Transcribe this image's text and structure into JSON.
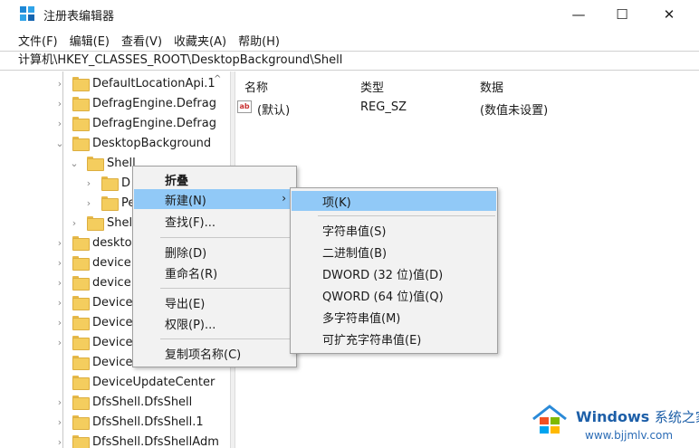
{
  "window": {
    "title": "注册表编辑器",
    "minimize_glyph": "—",
    "maximize_glyph": "☐",
    "close_glyph": "✕"
  },
  "menu": [
    "文件(F)",
    "编辑(E)",
    "查看(V)",
    "收藏夹(A)",
    "帮助(H)"
  ],
  "address": "计算机\\HKEY_CLASSES_ROOT\\DesktopBackground\\Shell",
  "tree": {
    "items": [
      {
        "label": "DefaultLocationApi.1",
        "caret": "›"
      },
      {
        "label": "DefragEngine.Defrag",
        "caret": "›"
      },
      {
        "label": "DefragEngine.Defrag",
        "caret": "›"
      },
      {
        "label": "DesktopBackground",
        "caret": "⌄"
      },
      {
        "label": "Shell",
        "caret": "⌄"
      },
      {
        "label": "D",
        "caret": "›"
      },
      {
        "label": "Pe",
        "caret": "›"
      },
      {
        "label": "Shell",
        "caret": "›"
      },
      {
        "label": "desktop",
        "caret": "›"
      },
      {
        "label": "device",
        "caret": "›"
      },
      {
        "label": "device.",
        "caret": "›"
      },
      {
        "label": "DeviceD",
        "caret": "›"
      },
      {
        "label": "DeviceF",
        "caret": "›"
      },
      {
        "label": "DeviceF",
        "caret": "›"
      },
      {
        "label": "DeviceU",
        "caret": ""
      },
      {
        "label": "DeviceUpdateCenter",
        "caret": ""
      },
      {
        "label": "DfsShell.DfsShell",
        "caret": "›"
      },
      {
        "label": "DfsShell.DfsShell.1",
        "caret": "›"
      },
      {
        "label": "DfsShell.DfsShellAdm",
        "caret": "›"
      }
    ],
    "scroll_up_glyph": "^"
  },
  "list": {
    "columns": [
      "名称",
      "类型",
      "数据"
    ],
    "rows": [
      {
        "icon": "ab",
        "name": "(默认)",
        "type": "REG_SZ",
        "data": "(数值未设置)"
      }
    ]
  },
  "context_menu": {
    "items": [
      "折叠",
      "新建(N)",
      "查找(F)...",
      "删除(D)",
      "重命名(R)",
      "导出(E)",
      "权限(P)...",
      "复制项名称(C)"
    ],
    "submenu_arrow": "›"
  },
  "submenu": {
    "items": [
      "项(K)",
      "字符串值(S)",
      "二进制值(B)",
      "DWORD (32 位)值(D)",
      "QWORD (64 位)值(Q)",
      "多字符串值(M)",
      "可扩充字符串值(E)"
    ]
  },
  "watermark": {
    "title": "Windows",
    "title_cn": "系统之家",
    "url": "www.bjjmlv.com"
  },
  "colors": {
    "highlight": "#91c9f7",
    "folder": "#f4cd5e",
    "watermark_blue": "#1d5fa8"
  }
}
